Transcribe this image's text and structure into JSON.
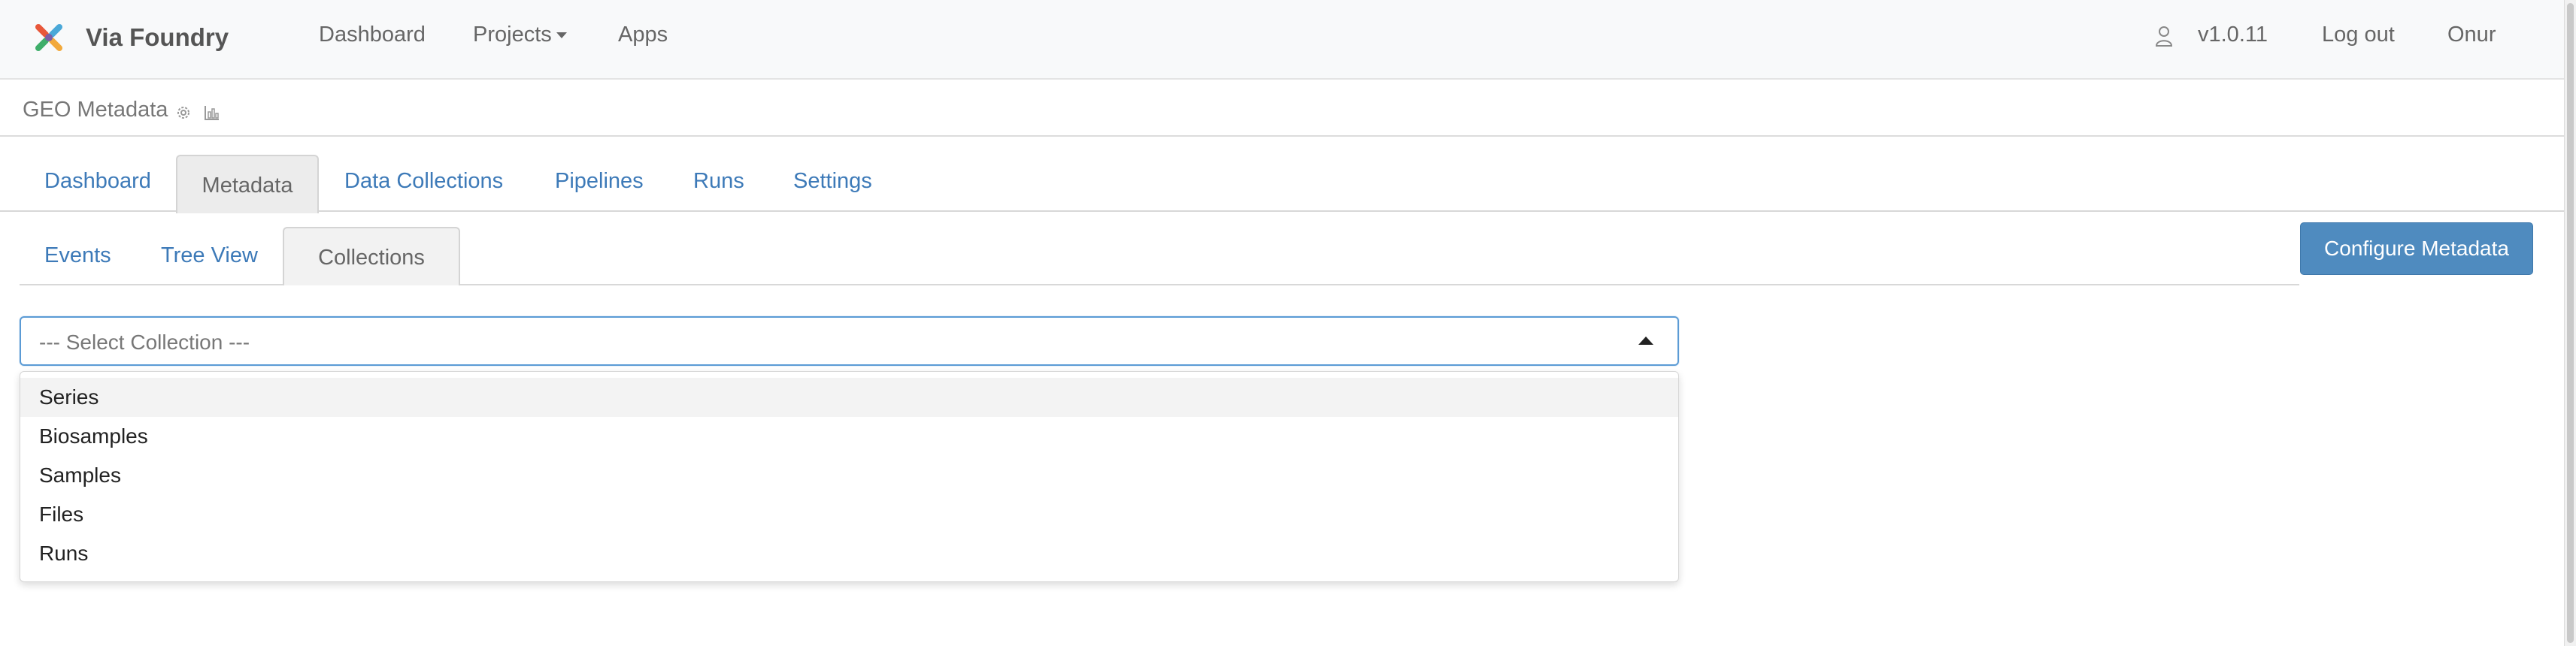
{
  "app": {
    "name": "Via Foundry",
    "logo": "via-foundry-logo-icon",
    "colors": {
      "link": "#3d7ab8",
      "primary_button": "#4f8bbf",
      "focus": "#5b9bd5"
    }
  },
  "navbar": {
    "links": [
      "Dashboard",
      "Projects",
      "Apps"
    ],
    "version": "v1.0.11",
    "logout": "Log out",
    "user": "Onur",
    "user_icon": "user-icon"
  },
  "project": {
    "title": "GEO Metadata",
    "icons": [
      "gear-icon",
      "bar-chart-icon"
    ]
  },
  "main_tabs": {
    "items": [
      "Dashboard",
      "Metadata",
      "Data Collections",
      "Pipelines",
      "Runs",
      "Settings"
    ],
    "active": "Metadata"
  },
  "sub_tabs": {
    "items": [
      "Events",
      "Tree View",
      "Collections"
    ],
    "active": "Collections"
  },
  "configure_button": "Configure Metadata",
  "collection_select": {
    "placeholder": "--- Select Collection ---",
    "options": [
      "Series",
      "Biosamples",
      "Samples",
      "Files",
      "Runs"
    ],
    "highlighted": "Series"
  }
}
